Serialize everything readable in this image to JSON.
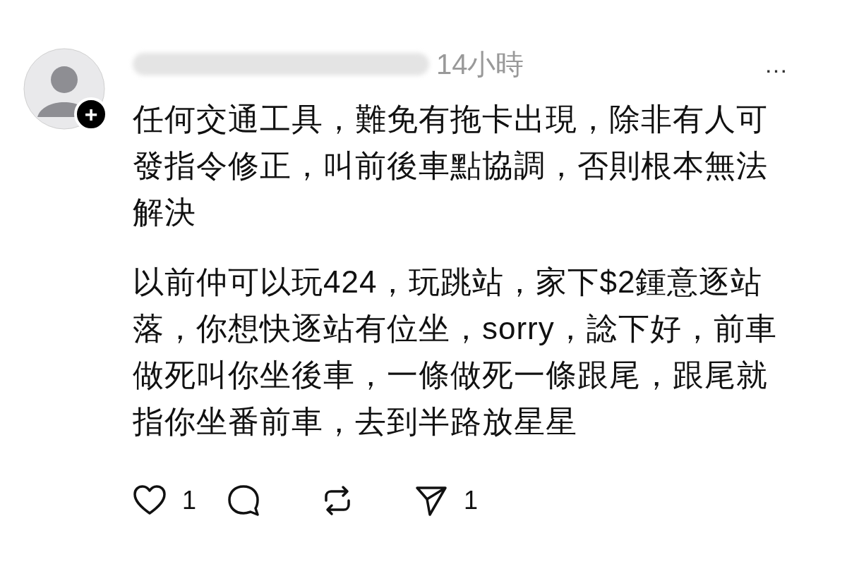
{
  "post": {
    "time": "14小時",
    "more": "…",
    "follow_badge": "+",
    "paragraphs": [
      {
        "lines": [
          "任何交通工具，難免有拖卡出現，除非有人可",
          "發指令修正，叫前後車點協調，否則根本無法",
          "解決"
        ]
      },
      {
        "lines": [
          "以前仲可以玩424，玩跳站，家下$2鍾意逐站",
          "落，你想快逐站有位坐，sorry，諗下好，前車",
          "做死叫你坐後車，一條做死一條跟尾，跟尾就",
          "指你坐番前車，去到半路放星星"
        ]
      }
    ],
    "actions": [
      {
        "kind": "like",
        "count": "1"
      },
      {
        "kind": "reply"
      },
      {
        "kind": "repost"
      },
      {
        "kind": "share",
        "count": "1"
      }
    ]
  }
}
